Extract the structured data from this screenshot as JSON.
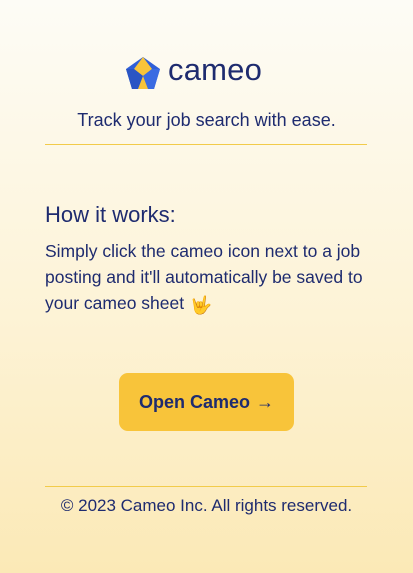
{
  "header": {
    "logo_text": "cameo",
    "logo_icon": "cameo-pentagon-icon"
  },
  "tagline": "Track your job search with ease.",
  "how_it_works": {
    "title": "How it works:",
    "body": "Simply click the cameo icon next to a job posting and it'll automatically be saved to your cameo sheet",
    "emoji": "🤟"
  },
  "cta": {
    "label": "Open Cameo",
    "arrow": "→"
  },
  "footer": {
    "copyright": "© 2023 Cameo Inc. All rights reserved."
  },
  "colors": {
    "brand_navy": "#1e2b6f",
    "brand_blue": "#2f5fd8",
    "accent_yellow": "#f8c43a",
    "divider_yellow": "#f2cb4a"
  }
}
